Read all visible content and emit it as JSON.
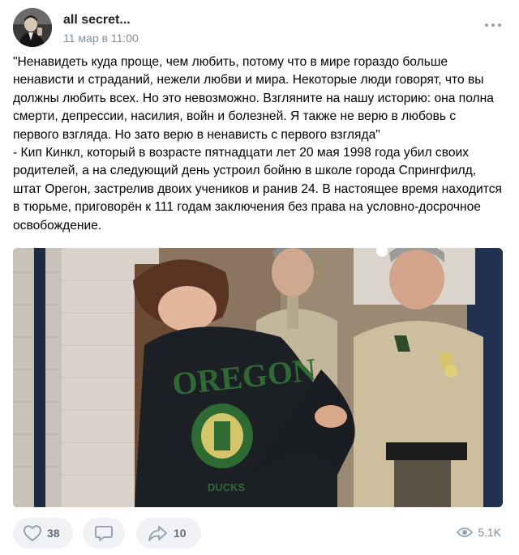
{
  "post": {
    "author": "all secret...",
    "date": "11 мар в 11:00",
    "text_paragraphs": [
      "\"Ненавидеть куда проще, чем любить, потому что в мире гораздо больше ненависти и страданий, нежели любви и мира. Некоторые люди говорят, что вы должны любить всех. Но это невозможно. Взгляните на нашу историю: она полна смерти, депрессии, насилия, войн и болезней. Я также не верю в любовь с первого взгляда. Но зато верю в ненависть с первого взгляда\"",
      "- Кип Кинкл, который в возрасте пятнадцати лет 20 мая 1998 года убил своих родителей, а на следующий день устроил бойню в школе города Спрингфилд, штат Орегон, застрелив двоих учеников и ранив 24. В настоящее время находится в тюрьме, приговорён к 111 годам заключения без права на условно-досрочное освобождение."
    ],
    "photo_print": {
      "sweatshirt_text": "OREGON",
      "crest_text": "DUCKS"
    }
  },
  "actions": {
    "likes": "38",
    "shares": "10",
    "views": "5.1K"
  },
  "icons": {
    "more": "more-dots-icon",
    "like": "heart-icon",
    "comment": "comment-bubble-icon",
    "share": "share-arrow-icon",
    "views": "eye-icon"
  },
  "colors": {
    "icon_gray": "#99a2ad",
    "secondary_text": "#818c99",
    "pill_bg": "#f0f2f5",
    "count_text": "#626d7a"
  }
}
